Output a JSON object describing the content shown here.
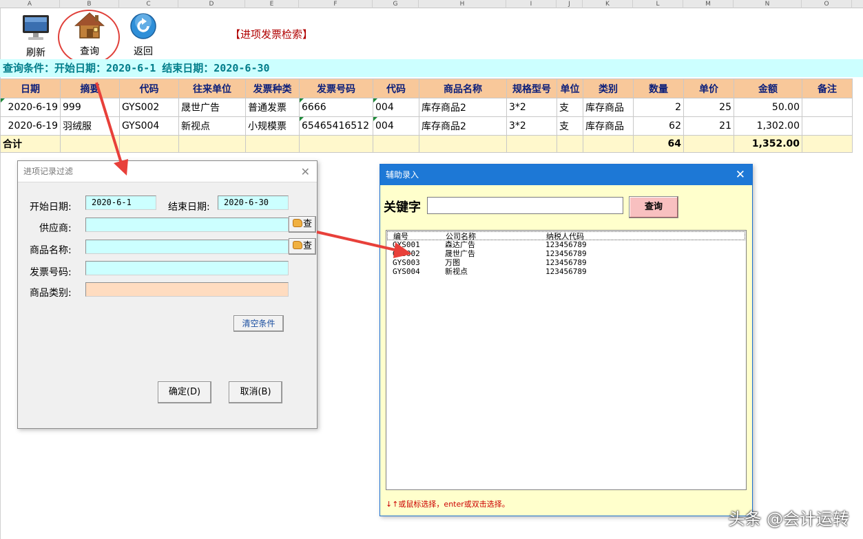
{
  "columns": [
    "A",
    "B",
    "C",
    "D",
    "E",
    "F",
    "G",
    "H",
    "I",
    "J",
    "K",
    "L",
    "M",
    "N",
    "O"
  ],
  "toolbar": {
    "refresh": "刷新",
    "query": "查询",
    "back": "返回",
    "title": "【进项发票检索】"
  },
  "condition": "查询条件：开始日期：2020-6-1 结束日期：2020-6-30",
  "table": {
    "headers": [
      "日期",
      "摘要",
      "代码",
      "往来单位",
      "发票种类",
      "发票号码",
      "代码",
      "商品名称",
      "规格型号",
      "单位",
      "类别",
      "数量",
      "单价",
      "金额",
      "备注"
    ],
    "rows": [
      [
        "2020-6-19",
        "999",
        "GYS002",
        "晟世广告",
        "普通发票",
        "6666",
        "004",
        "库存商品2",
        "3*2",
        "支",
        "库存商品",
        "2",
        "25",
        "50.00",
        ""
      ],
      [
        "2020-6-19",
        "羽绒服",
        "GYS004",
        "新视点",
        "小规模票",
        "65465416512",
        "004",
        "库存商品2",
        "3*2",
        "支",
        "库存商品",
        "62",
        "21",
        "1,302.00",
        ""
      ]
    ],
    "total_label": "合计",
    "total_qty": "64",
    "total_amount": "1,352.00"
  },
  "filter_dialog": {
    "title": "进项记录过滤",
    "start_label": "开始日期:",
    "start_value": "2020-6-1",
    "end_label": "结束日期:",
    "end_value": "2020-6-30",
    "supplier_label": "供应商:",
    "product_label": "商品名称:",
    "invoice_label": "发票号码:",
    "category_label": "商品类别:",
    "lookup": "查",
    "clear": "清空条件",
    "ok": "确定(D)",
    "cancel": "取消(B)"
  },
  "assist_dialog": {
    "title": "辅助录入",
    "keyword_label": "关键字",
    "query": "查询",
    "list_headers": [
      "编号",
      "公司名称",
      "纳税人代码"
    ],
    "list_rows": [
      [
        "GYS001",
        "森达广告",
        "123456789"
      ],
      [
        "GYS002",
        "晟世广告",
        "123456789"
      ],
      [
        "GYS003",
        "万图",
        "123456789"
      ],
      [
        "GYS004",
        "新视点",
        "123456789"
      ]
    ],
    "hint": "↓↑或鼠标选择，enter或双击选择。"
  },
  "watermark": "头条 @会计运转",
  "colors": {
    "header_bg": "#f8c89a",
    "condition_bg": "#ccffff",
    "total_bg": "#fff8cc",
    "highlight_circle": "#e0403a",
    "arrow": "#e8403a"
  }
}
